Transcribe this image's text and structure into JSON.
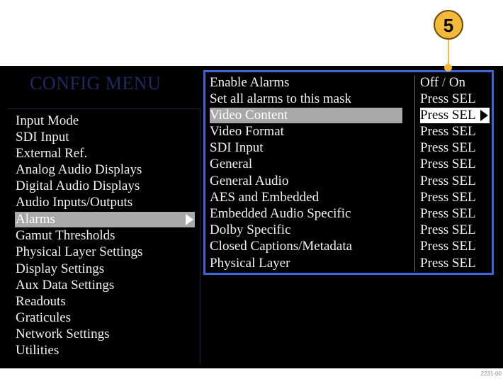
{
  "title": "CONFIG MENU",
  "callout_number": "5",
  "figure_id": "2231-00",
  "colors": {
    "highlight": "#3d63d6",
    "callout": "#f3b93a",
    "selected_bg": "#a9a9a9"
  },
  "menu": [
    {
      "label": "Input Mode"
    },
    {
      "label": "SDI Input"
    },
    {
      "label": "External Ref."
    },
    {
      "label": "Analog Audio Displays"
    },
    {
      "label": "Digital Audio Displays"
    },
    {
      "label": "Audio Inputs/Outputs"
    },
    {
      "label": "Alarms",
      "selected": true
    },
    {
      "label": "Gamut Thresholds"
    },
    {
      "label": "Physical Layer Settings"
    },
    {
      "label": "Display Settings"
    },
    {
      "label": "Aux Data Settings"
    },
    {
      "label": "Readouts"
    },
    {
      "label": "Graticules"
    },
    {
      "label": "Network Settings"
    },
    {
      "label": "Utilities"
    }
  ],
  "enable_alarms": {
    "label": "Enable Alarms",
    "off": "Off",
    "separator": "/",
    "on": "On"
  },
  "options": [
    {
      "label": "Set all alarms to this mask",
      "value": "Press SEL"
    },
    {
      "label": "Video Content",
      "value": "Press SEL",
      "selected": true
    },
    {
      "label": "Video Format",
      "value": "Press SEL"
    },
    {
      "label": "SDI Input",
      "value": "Press SEL"
    },
    {
      "label": "General",
      "value": "Press SEL"
    },
    {
      "label": "General Audio",
      "value": "Press SEL"
    },
    {
      "label": "AES and Embedded",
      "value": "Press SEL"
    },
    {
      "label": "Embedded Audio Specific",
      "value": "Press SEL"
    },
    {
      "label": "Dolby Specific",
      "value": "Press SEL"
    },
    {
      "label": "Closed Captions/Metadata",
      "value": "Press SEL"
    },
    {
      "label": "Physical Layer",
      "value": "Press SEL"
    }
  ]
}
